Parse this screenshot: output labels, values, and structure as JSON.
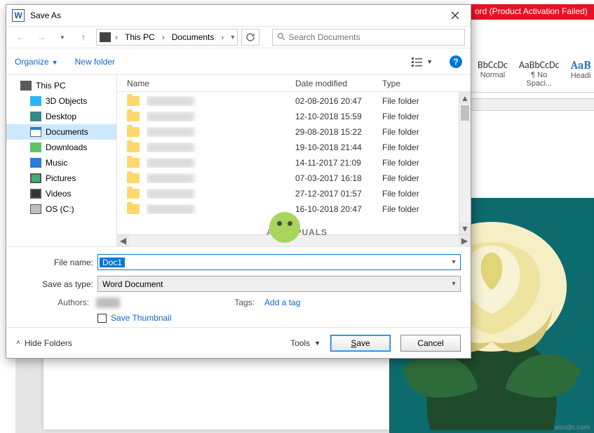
{
  "bg": {
    "title_fragment": "ord (Product Activation Failed)",
    "styles": [
      {
        "sample": "BbCcDc",
        "label": "Normal"
      },
      {
        "sample": "AaBbCcDc",
        "label": "¶ No Spaci..."
      },
      {
        "sample": "AaB",
        "label": "Headi"
      }
    ]
  },
  "dialog": {
    "title": "Save As",
    "breadcrumb": {
      "seg1": "This PC",
      "seg2": "Documents"
    },
    "search_placeholder": "Search Documents",
    "toolbar": {
      "organize": "Organize",
      "newfolder": "New folder"
    },
    "tree": [
      {
        "icon": "pc",
        "label": "This PC"
      },
      {
        "icon": "obj",
        "label": "3D Objects"
      },
      {
        "icon": "dsk",
        "label": "Desktop"
      },
      {
        "icon": "doc",
        "label": "Documents",
        "selected": true
      },
      {
        "icon": "dl",
        "label": "Downloads"
      },
      {
        "icon": "mus",
        "label": "Music"
      },
      {
        "icon": "pic",
        "label": "Pictures"
      },
      {
        "icon": "vid",
        "label": "Videos"
      },
      {
        "icon": "drv",
        "label": "OS (C:)"
      }
    ],
    "columns": {
      "name": "Name",
      "date": "Date modified",
      "type": "Type"
    },
    "rows": [
      {
        "date": "02-08-2016 20:47",
        "type": "File folder"
      },
      {
        "date": "12-10-2018 15:59",
        "type": "File folder"
      },
      {
        "date": "29-08-2018 15:22",
        "type": "File folder"
      },
      {
        "date": "19-10-2018 21:44",
        "type": "File folder"
      },
      {
        "date": "14-11-2017 21:09",
        "type": "File folder"
      },
      {
        "date": "07-03-2017 16:18",
        "type": "File folder"
      },
      {
        "date": "27-12-2017 01:57",
        "type": "File folder"
      },
      {
        "date": "16-10-2018 20:47",
        "type": "File folder"
      }
    ],
    "form": {
      "filename_label": "File name:",
      "filename_value": "Doc1",
      "savetype_label": "Save as type:",
      "savetype_value": "Word Document",
      "authors_label": "Authors:",
      "tags_label": "Tags:",
      "tags_link": "Add a tag",
      "thumb_label": "Save Thumbnail"
    },
    "footer": {
      "hide": "Hide Folders",
      "tools": "Tools",
      "save": "Save",
      "cancel": "Cancel"
    }
  },
  "watermark": {
    "left": "A",
    "right": "PUALS"
  },
  "credit": "wsxdn.com"
}
